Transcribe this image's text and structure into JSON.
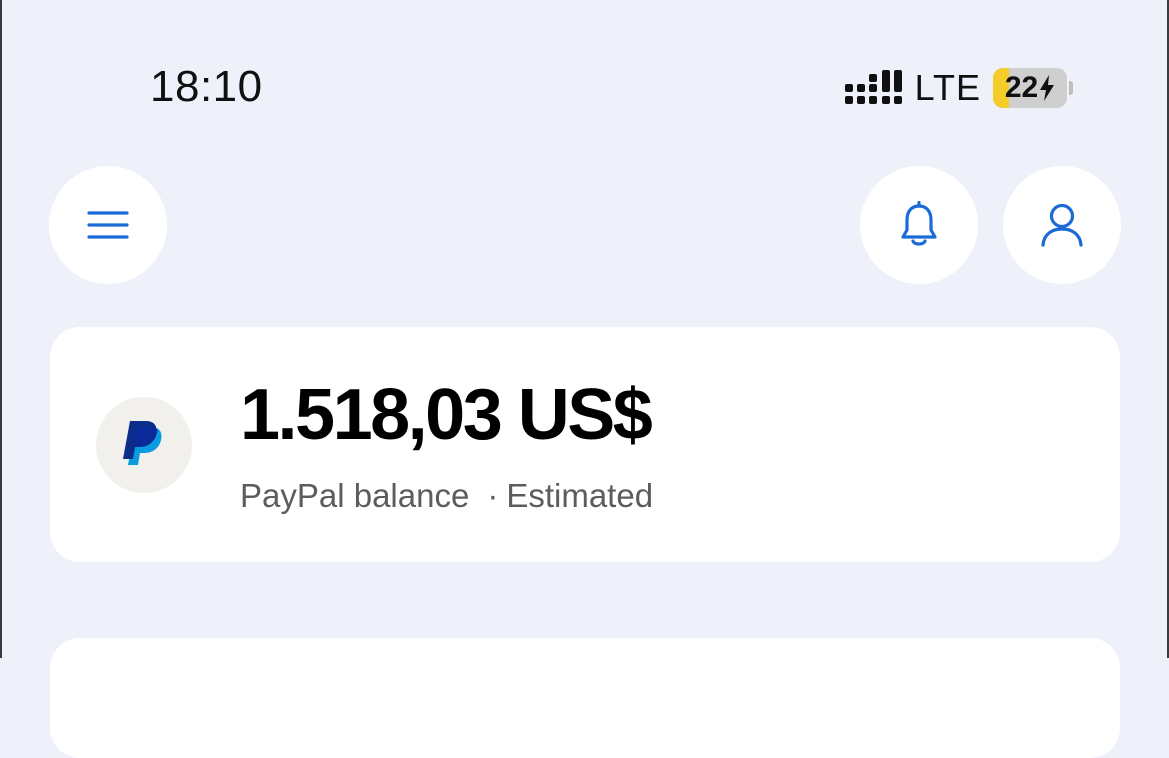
{
  "status_bar": {
    "time": "18:10",
    "network": "LTE",
    "battery_level": "22",
    "battery_charging": true,
    "battery_fraction": 0.22,
    "battery_color": "#f4cd2a"
  },
  "header": {
    "menu_icon": "hamburger-menu-icon",
    "notifications_icon": "bell-icon",
    "profile_icon": "person-icon",
    "accent_color": "#1b6bd6"
  },
  "balance_card": {
    "logo": "paypal-logo",
    "amount": "1.518,03 US$",
    "label": "PayPal balance",
    "separator": "·",
    "status": "Estimated"
  }
}
